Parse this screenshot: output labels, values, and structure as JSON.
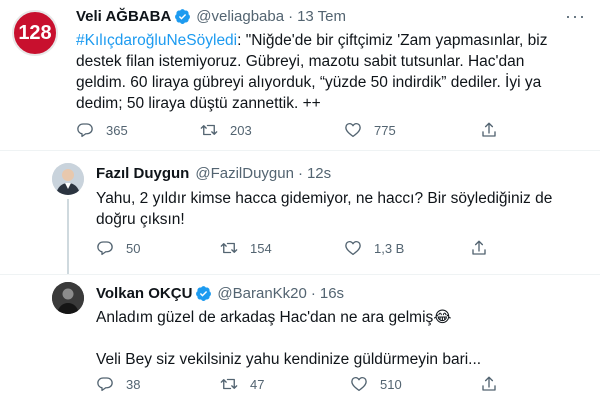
{
  "tweets": [
    {
      "badge": "128",
      "name": "Veli AĞBABA",
      "handle": "@veliagbaba",
      "time": "13 Tem",
      "hashtag": "#KılıçdaroğluNeSöyledi",
      "lines": [
        ": \"Niğde'de bir çiftçimiz 'Zam yapmasınlar, biz",
        "destek filan istemiyoruz. Gübreyi, mazotu sabit tutsunlar. Hac'dan",
        "geldim. 60 liraya gübreyi alıyorduk, “yüzde 50 indirdik” dediler. İyi ya",
        "dedim; 50 liraya düştü zannettik. ++"
      ],
      "replies": "365",
      "retweets": "203",
      "likes": "775"
    },
    {
      "name": "Fazıl Duygun",
      "handle": "@FazilDuygun",
      "time": "12s",
      "lines": [
        "Yahu, 2 yıldır kimse hacca gidemiyor, ne haccı? Bir söylediğiniz de",
        "doğru çıksın!"
      ],
      "replies": "50",
      "retweets": "154",
      "likes": "1,3 B"
    },
    {
      "name": "Volkan OKÇU",
      "handle": "@BaranKk20",
      "time": "16s",
      "lines": [
        "Anladım güzel de arkadaş Hac'dan ne ara gelmiş😂",
        "",
        "Veli Bey siz vekilsiniz yahu kendinize güldürmeyin bari..."
      ],
      "replies": "38",
      "retweets": "47",
      "likes": "510"
    }
  ],
  "colors": {
    "accent": "#1d9bf0",
    "badge": "#c8102e",
    "muted": "#536471"
  }
}
